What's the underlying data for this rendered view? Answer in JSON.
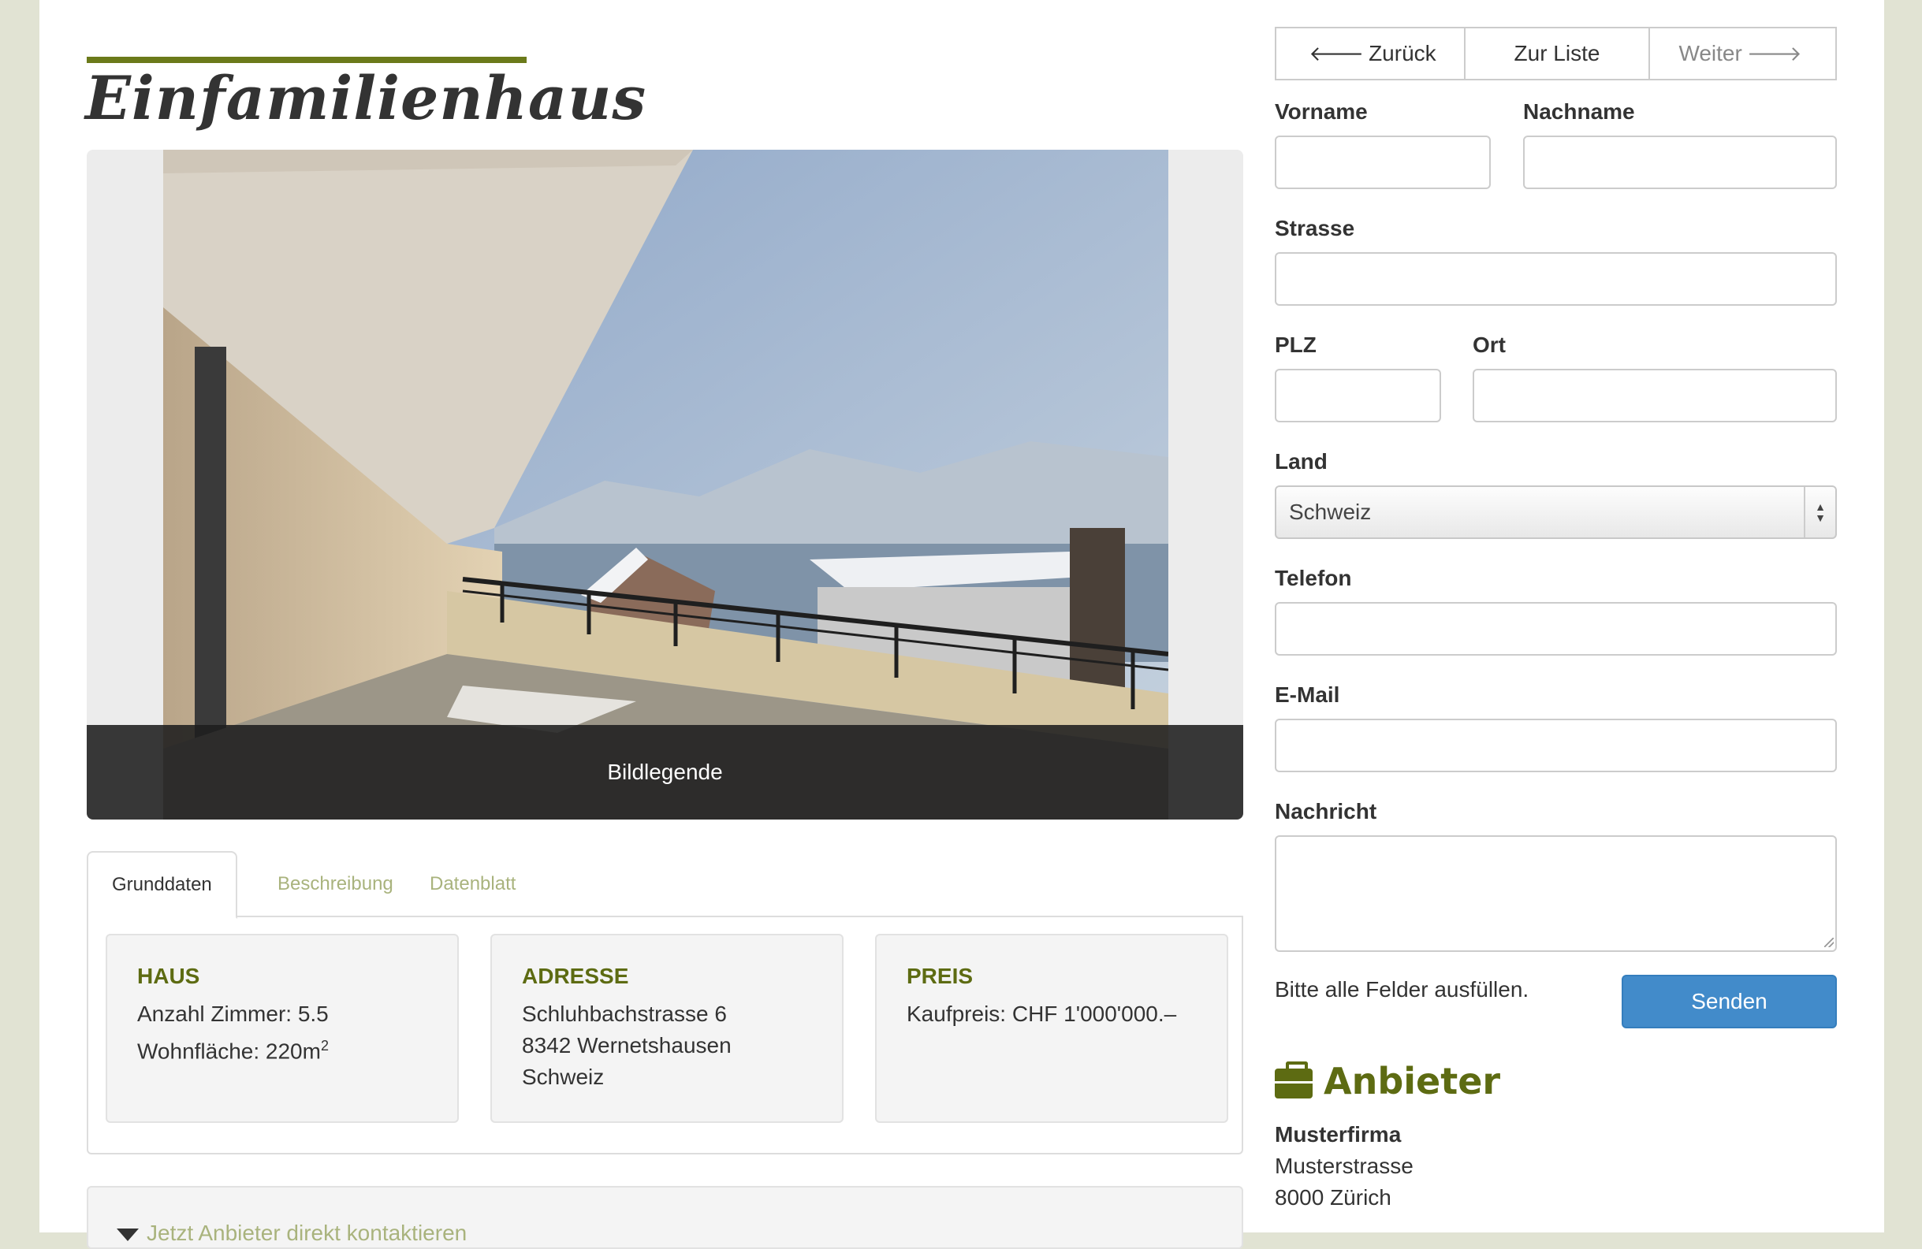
{
  "listing": {
    "title": "Einfamilienhaus",
    "image_caption": "Bildlegende"
  },
  "tabs": [
    {
      "label": "Grunddaten",
      "active": true
    },
    {
      "label": "Beschreibung",
      "active": false
    },
    {
      "label": "Datenblatt",
      "active": false
    }
  ],
  "cards": {
    "haus": {
      "heading": "HAUS",
      "rooms": "Anzahl Zimmer: 5.5",
      "area_prefix": "Wohnfläche: 220m",
      "area_sup": "2"
    },
    "adresse": {
      "heading": "ADRESSE",
      "street": "Schluhbachstrasse 6",
      "city": "8342 Wernetshausen",
      "country": "Schweiz"
    },
    "preis": {
      "heading": "PREIS",
      "price": "Kaufpreis: CHF 1'000'000.–"
    }
  },
  "contact_bar": {
    "label": "Jetzt Anbieter direkt kontaktieren"
  },
  "pager": {
    "back": "Zurück",
    "list": "Zur Liste",
    "next": "Weiter"
  },
  "form": {
    "vorname_label": "Vorname",
    "nachname_label": "Nachname",
    "strasse_label": "Strasse",
    "plz_label": "PLZ",
    "ort_label": "Ort",
    "land_label": "Land",
    "land_value": "Schweiz",
    "telefon_label": "Telefon",
    "email_label": "E-Mail",
    "nachricht_label": "Nachricht",
    "hint": "Bitte alle Felder ausfüllen.",
    "submit": "Senden"
  },
  "anbieter": {
    "title": "Anbieter",
    "name": "Musterfirma",
    "street": "Musterstrasse",
    "city": "8000 Zürich"
  },
  "colors": {
    "accent": "#5d6b12",
    "link": "#a9b37d",
    "button": "#428bca"
  },
  "icons": {
    "back": "arrow-left-icon",
    "next": "arrow-right-icon",
    "anbieter": "briefcase-icon",
    "contact": "funnel-icon"
  }
}
